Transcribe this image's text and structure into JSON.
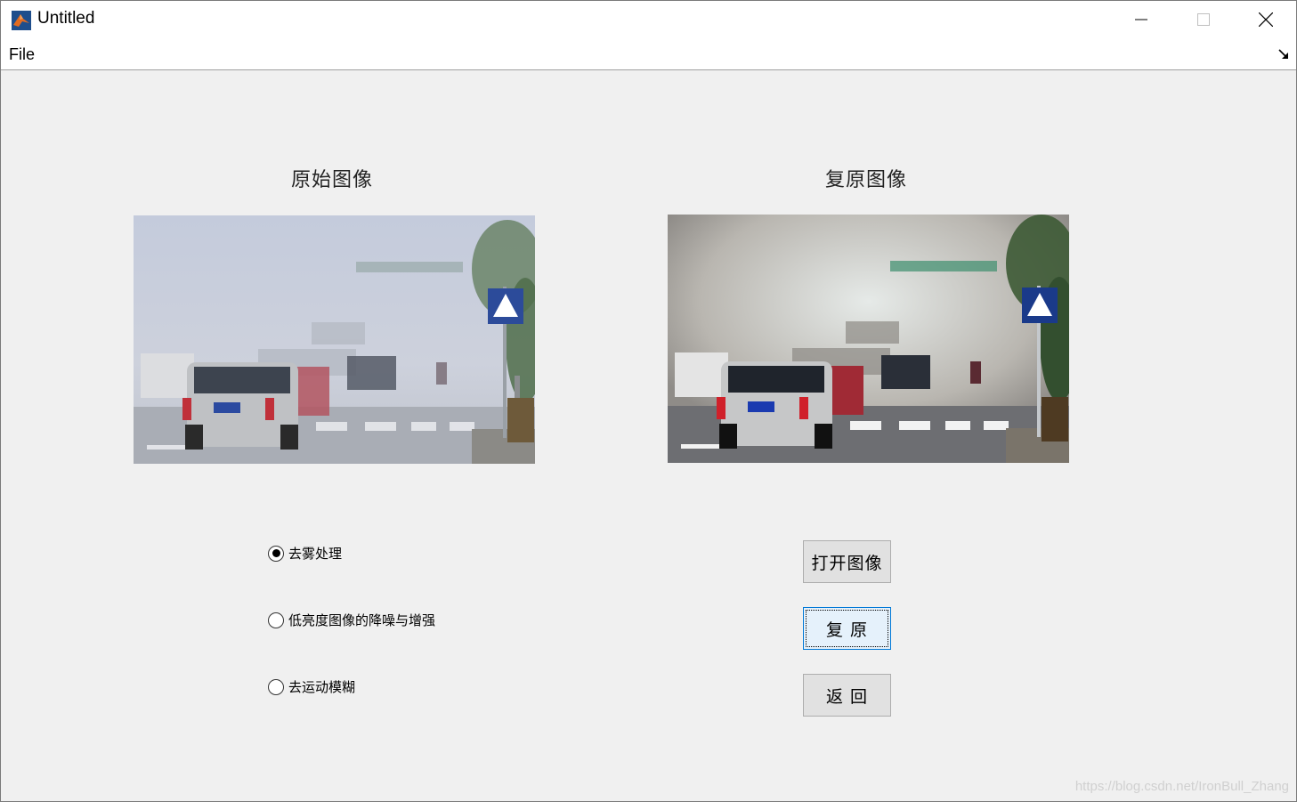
{
  "window": {
    "title": "Untitled"
  },
  "menu": {
    "file": "File"
  },
  "panels": {
    "original_title": "原始图像",
    "restored_title": "复原图像"
  },
  "radios": [
    {
      "label": "去雾处理",
      "checked": true
    },
    {
      "label": "低亮度图像的降噪与增强",
      "checked": false
    },
    {
      "label": "去运动模糊",
      "checked": false
    }
  ],
  "buttons": {
    "open": "打开图像",
    "restore": "复 原",
    "back": "返 回"
  },
  "watermark": "https://blog.csdn.net/IronBull_Zhang",
  "colors": {
    "accent": "#0078d7",
    "window_bg": "#f0f0f0"
  }
}
